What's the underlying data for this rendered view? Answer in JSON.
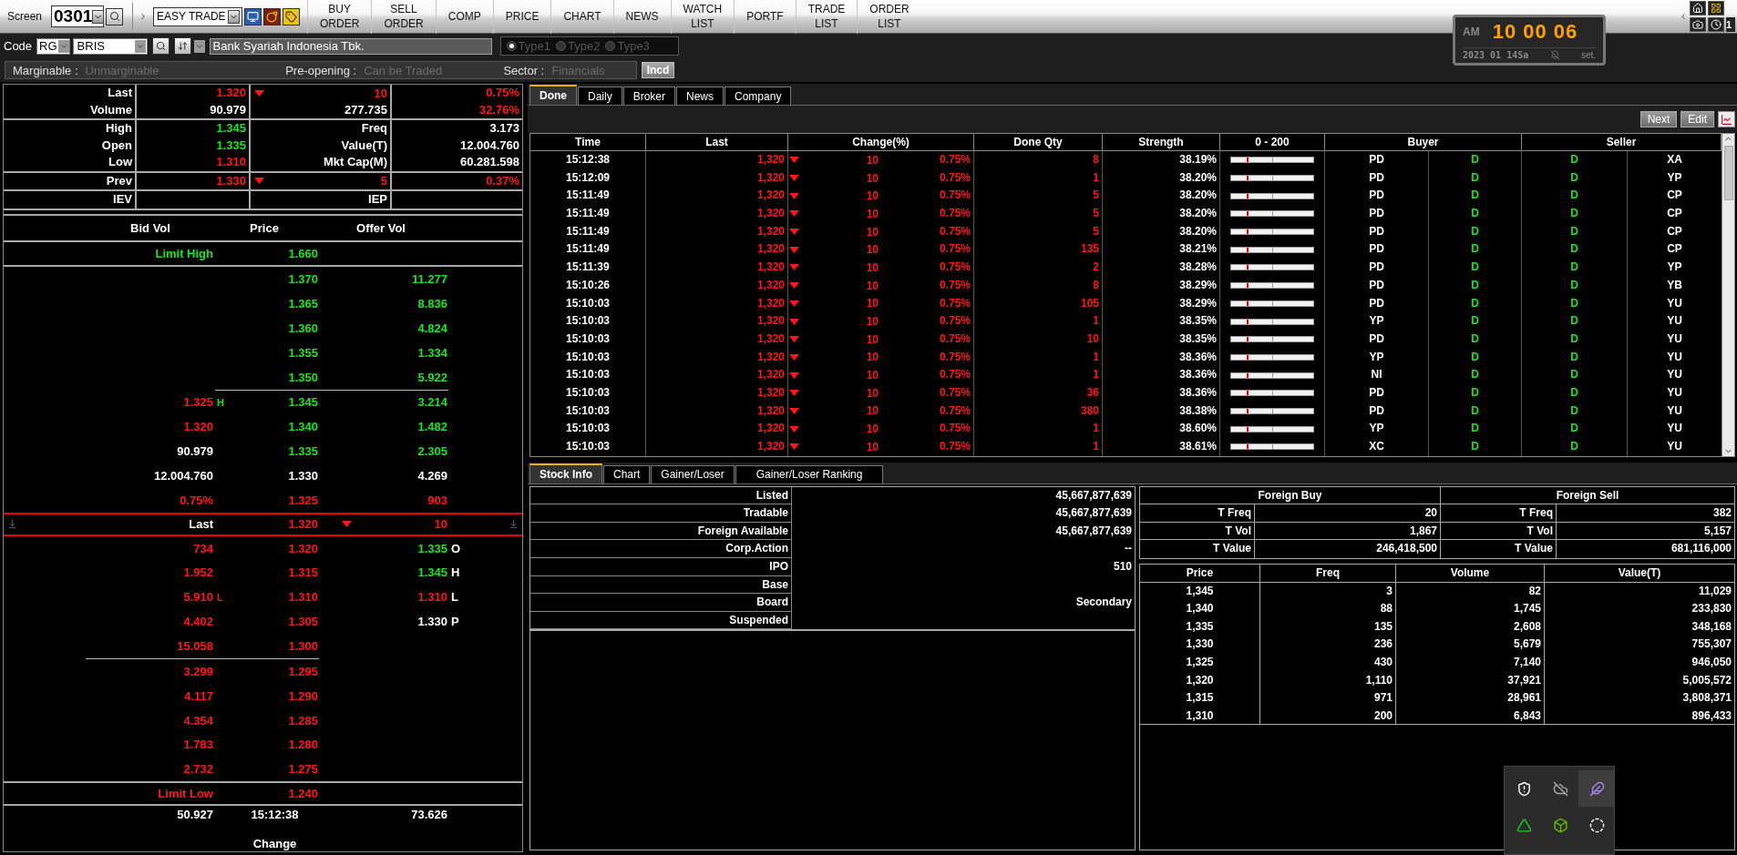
{
  "toolbar": {
    "screen_label": "Screen",
    "screen_code": "0301",
    "workspace": "EASY TRADE",
    "menu": [
      {
        "lines": [
          "BUY",
          "ORDER"
        ]
      },
      {
        "lines": [
          "SELL",
          "ORDER"
        ]
      },
      {
        "lines": [
          "COMP"
        ]
      },
      {
        "lines": [
          "PRICE"
        ]
      },
      {
        "lines": [
          "CHART"
        ]
      },
      {
        "lines": [
          "NEWS"
        ]
      },
      {
        "lines": [
          "WATCH",
          "LIST"
        ]
      },
      {
        "lines": [
          "PORTF"
        ]
      },
      {
        "lines": [
          "TRADE",
          "LIST"
        ]
      },
      {
        "lines": [
          "ORDER",
          "LIST"
        ]
      }
    ],
    "corner_badge": "1"
  },
  "clock": {
    "period": "AM",
    "time": "10 00 06",
    "date": "2023 01 14Sa",
    "set": "set."
  },
  "code_bar": {
    "label": "Code",
    "board": "RG",
    "code": "BRIS",
    "name": "Bank Syariah Indonesia Tbk.",
    "types": [
      {
        "label": "Type1",
        "selected": true
      },
      {
        "label": "Type2",
        "selected": false
      },
      {
        "label": "Type3",
        "selected": false
      }
    ]
  },
  "info_bar": {
    "fields": [
      {
        "label": "Marginable :",
        "value": "Unmarginable"
      },
      {
        "label": "Pre-opening :",
        "value": "Can be Traded"
      },
      {
        "label": "Sector :",
        "value": "Financials"
      }
    ],
    "button": "Incd"
  },
  "summary": [
    {
      "rows": [
        {
          "cells": [
            {
              "kind": "label",
              "text": "Last"
            },
            {
              "kind": "value",
              "text": "1.320",
              "color": "#ff1818"
            },
            {
              "kind": "value",
              "text": "10",
              "color": "#ff1818",
              "falling": true
            },
            {
              "kind": "value",
              "text": "0.75%",
              "color": "#ff1818"
            }
          ]
        },
        {
          "cells": [
            {
              "kind": "label",
              "text": "Volume"
            },
            {
              "kind": "value",
              "text": "90.979",
              "color": "#ffffff"
            },
            {
              "kind": "value",
              "text": "277.735",
              "color": "#ffffff"
            },
            {
              "kind": "value",
              "text": "32.76%",
              "color": "#ff1818"
            }
          ]
        }
      ]
    },
    {
      "rows": [
        {
          "cells": [
            {
              "kind": "label",
              "text": "High"
            },
            {
              "kind": "value",
              "text": "1.345",
              "color": "#22e022"
            },
            {
              "kind": "label",
              "text": "Freq"
            },
            {
              "kind": "value",
              "text": "3.173",
              "color": "#ffffff"
            }
          ]
        },
        {
          "cells": [
            {
              "kind": "label",
              "text": "Open"
            },
            {
              "kind": "value",
              "text": "1.335",
              "color": "#22e022"
            },
            {
              "kind": "label",
              "text": "Value(T)"
            },
            {
              "kind": "value",
              "text": "12.004.760",
              "color": "#ffffff"
            }
          ]
        },
        {
          "cells": [
            {
              "kind": "label",
              "text": "Low"
            },
            {
              "kind": "value",
              "text": "1.310",
              "color": "#ff1818"
            },
            {
              "kind": "label",
              "text": "Mkt Cap(M)"
            },
            {
              "kind": "value",
              "text": "60.281.598",
              "color": "#ffffff"
            }
          ]
        }
      ]
    },
    {
      "rows": [
        {
          "cells": [
            {
              "kind": "label",
              "text": "Prev"
            },
            {
              "kind": "value",
              "text": "1.330",
              "color": "#ff1818"
            },
            {
              "kind": "value",
              "text": "5",
              "color": "#ff1818",
              "falling": true
            },
            {
              "kind": "value",
              "text": "0.37%",
              "color": "#ff1818"
            }
          ]
        }
      ]
    },
    {
      "rows": [
        {
          "cells": [
            {
              "kind": "label",
              "text": "IEV"
            },
            {
              "kind": "value"
            },
            {
              "kind": "label",
              "text": "IEP"
            },
            {
              "kind": "value"
            }
          ]
        }
      ]
    }
  ],
  "orderbook": {
    "columns": [
      "Bid Vol",
      "Price",
      "Offer Vol"
    ],
    "limit_high": {
      "label": "Limit High",
      "price": "1.660",
      "color": "#22e022"
    },
    "offers": [
      {
        "price": "1.370",
        "volume": "11.277",
        "color": "#22e022"
      },
      {
        "price": "1.365",
        "volume": "8.836",
        "color": "#22e022"
      },
      {
        "price": "1.360",
        "volume": "4.824",
        "color": "#22e022"
      },
      {
        "price": "1.355",
        "volume": "1.334",
        "color": "#22e022"
      },
      {
        "price": "1.350",
        "volume": "5.922",
        "color": "#22e022"
      },
      {
        "price": "1.345",
        "volume": "3.214",
        "color": "#22e022",
        "side": {
          "text": "1.325",
          "color": "#ff1818",
          "marker": {
            "text": "H",
            "color": "#22e022"
          }
        }
      },
      {
        "price": "1.340",
        "volume": "1.482",
        "color": "#22e022",
        "side": {
          "text": "1.320",
          "color": "#ff1818"
        }
      },
      {
        "price": "1.335",
        "volume": "2.305",
        "color": "#22e022",
        "side": {
          "text": "90.979",
          "color": "#ffffff"
        }
      },
      {
        "price": "1.330",
        "volume": "4.269",
        "color": "#ffffff",
        "side": {
          "text": "12.004.760",
          "color": "#ffffff"
        }
      },
      {
        "price": "1.325",
        "volume": "903",
        "color": "#ff1818",
        "side": {
          "text": "0.75%",
          "color": "#ff1818"
        }
      }
    ],
    "last": {
      "label": "Last",
      "price": "1.320",
      "color": "#ff1818",
      "falling": true,
      "change": "10"
    },
    "bids": [
      {
        "volume": "734",
        "price": "1.320",
        "color": "#ff1818",
        "side": {
          "text": "1.335",
          "color": "#22e022",
          "marker": {
            "text": "O",
            "color": "#ffffff"
          }
        }
      },
      {
        "volume": "1.952",
        "price": "1.315",
        "color": "#ff1818",
        "side": {
          "text": "1.345",
          "color": "#22e022",
          "marker": {
            "text": "H",
            "color": "#ffffff"
          }
        }
      },
      {
        "volume": "5.910",
        "price": "1.310",
        "color": "#ff1818",
        "marker": {
          "text": "L",
          "color": "#ff1818"
        },
        "side": {
          "text": "1.310",
          "color": "#ff1818",
          "marker": {
            "text": "L",
            "color": "#ffffff"
          }
        }
      },
      {
        "volume": "4.402",
        "price": "1.305",
        "color": "#ff1818",
        "side": {
          "text": "1.330",
          "color": "#ffffff",
          "marker": {
            "text": "P",
            "color": "#ffffff"
          }
        }
      },
      {
        "volume": "15.058",
        "price": "1.300",
        "color": "#ff1818"
      },
      {
        "volume": "3.299",
        "price": "1.295",
        "color": "#ff1818"
      },
      {
        "volume": "4.117",
        "price": "1.290",
        "color": "#ff1818"
      },
      {
        "volume": "4.354",
        "price": "1.285",
        "color": "#ff1818"
      },
      {
        "volume": "1.783",
        "price": "1.280",
        "color": "#ff1818"
      },
      {
        "volume": "2.732",
        "price": "1.275",
        "color": "#ff1818"
      }
    ],
    "limit_low": {
      "label": "Limit Low",
      "price": "1.240",
      "color": "#ff1818"
    },
    "footer": {
      "bid_total": "50.927",
      "time": "15:12:38",
      "offer_total": "73.626",
      "caption": "Change"
    }
  },
  "done_panel": {
    "tabs": [
      {
        "label": "Done",
        "selected": true
      },
      {
        "label": "Daily",
        "selected": false
      },
      {
        "label": "Broker",
        "selected": false
      },
      {
        "label": "News",
        "selected": false
      },
      {
        "label": "Company",
        "selected": false
      }
    ],
    "buttons": [
      "Next",
      "Edit"
    ],
    "columns": [
      "Time",
      "Last",
      "Change(%)",
      "Done Qty",
      "Strength",
      "0 - 200",
      "Buyer",
      "Seller"
    ],
    "rows": [
      {
        "time": "15:12:38",
        "last": "1,320",
        "color": "#ff1818",
        "falling": true,
        "change": "10",
        "pct": "0.75%",
        "qty": "8",
        "strength": "38.19%",
        "level": 0.19,
        "buyer": "PD",
        "buyer_type": "D",
        "seller_type": "D",
        "seller": "XA"
      },
      {
        "time": "15:12:09",
        "last": "1,320",
        "color": "#ff1818",
        "falling": true,
        "change": "10",
        "pct": "0.75%",
        "qty": "1",
        "strength": "38.20%",
        "level": 0.19,
        "buyer": "PD",
        "buyer_type": "D",
        "seller_type": "D",
        "seller": "YP"
      },
      {
        "time": "15:11:49",
        "last": "1,320",
        "color": "#ff1818",
        "falling": true,
        "change": "10",
        "pct": "0.75%",
        "qty": "5",
        "strength": "38.20%",
        "level": 0.19,
        "buyer": "PD",
        "buyer_type": "D",
        "seller_type": "D",
        "seller": "CP"
      },
      {
        "time": "15:11:49",
        "last": "1,320",
        "color": "#ff1818",
        "falling": true,
        "change": "10",
        "pct": "0.75%",
        "qty": "5",
        "strength": "38.20%",
        "level": 0.19,
        "buyer": "PD",
        "buyer_type": "D",
        "seller_type": "D",
        "seller": "CP"
      },
      {
        "time": "15:11:49",
        "last": "1,320",
        "color": "#ff1818",
        "falling": true,
        "change": "10",
        "pct": "0.75%",
        "qty": "5",
        "strength": "38.20%",
        "level": 0.19,
        "buyer": "PD",
        "buyer_type": "D",
        "seller_type": "D",
        "seller": "CP"
      },
      {
        "time": "15:11:49",
        "last": "1,320",
        "color": "#ff1818",
        "falling": true,
        "change": "10",
        "pct": "0.75%",
        "qty": "135",
        "strength": "38.21%",
        "level": 0.19,
        "buyer": "PD",
        "buyer_type": "D",
        "seller_type": "D",
        "seller": "CP"
      },
      {
        "time": "15:11:39",
        "last": "1,320",
        "color": "#ff1818",
        "falling": true,
        "change": "10",
        "pct": "0.75%",
        "qty": "2",
        "strength": "38.28%",
        "level": 0.19,
        "buyer": "PD",
        "buyer_type": "D",
        "seller_type": "D",
        "seller": "YP"
      },
      {
        "time": "15:10:26",
        "last": "1,320",
        "color": "#ff1818",
        "falling": true,
        "change": "10",
        "pct": "0.75%",
        "qty": "8",
        "strength": "38.29%",
        "level": 0.19,
        "buyer": "PD",
        "buyer_type": "D",
        "seller_type": "D",
        "seller": "YB"
      },
      {
        "time": "15:10:03",
        "last": "1,320",
        "color": "#ff1818",
        "falling": true,
        "change": "10",
        "pct": "0.75%",
        "qty": "105",
        "strength": "38.29%",
        "level": 0.19,
        "buyer": "PD",
        "buyer_type": "D",
        "seller_type": "D",
        "seller": "YU"
      },
      {
        "time": "15:10:03",
        "last": "1,320",
        "color": "#ff1818",
        "falling": true,
        "change": "10",
        "pct": "0.75%",
        "qty": "1",
        "strength": "38.35%",
        "level": 0.19,
        "buyer": "YP",
        "buyer_type": "D",
        "seller_type": "D",
        "seller": "YU"
      },
      {
        "time": "15:10:03",
        "last": "1,320",
        "color": "#ff1818",
        "falling": true,
        "change": "10",
        "pct": "0.75%",
        "qty": "10",
        "strength": "38.35%",
        "level": 0.19,
        "buyer": "PD",
        "buyer_type": "D",
        "seller_type": "D",
        "seller": "YU"
      },
      {
        "time": "15:10:03",
        "last": "1,320",
        "color": "#ff1818",
        "falling": true,
        "change": "10",
        "pct": "0.75%",
        "qty": "1",
        "strength": "38.36%",
        "level": 0.19,
        "buyer": "YP",
        "buyer_type": "D",
        "seller_type": "D",
        "seller": "YU"
      },
      {
        "time": "15:10:03",
        "last": "1,320",
        "color": "#ff1818",
        "falling": true,
        "change": "10",
        "pct": "0.75%",
        "qty": "1",
        "strength": "38.36%",
        "level": 0.19,
        "buyer": "NI",
        "buyer_type": "D",
        "seller_type": "D",
        "seller": "YU"
      },
      {
        "time": "15:10:03",
        "last": "1,320",
        "color": "#ff1818",
        "falling": true,
        "change": "10",
        "pct": "0.75%",
        "qty": "36",
        "strength": "38.36%",
        "level": 0.19,
        "buyer": "PD",
        "buyer_type": "D",
        "seller_type": "D",
        "seller": "YU"
      },
      {
        "time": "15:10:03",
        "last": "1,320",
        "color": "#ff1818",
        "falling": true,
        "change": "10",
        "pct": "0.75%",
        "qty": "380",
        "strength": "38.38%",
        "level": 0.19,
        "buyer": "PD",
        "buyer_type": "D",
        "seller_type": "D",
        "seller": "YU"
      },
      {
        "time": "15:10:03",
        "last": "1,320",
        "color": "#ff1818",
        "falling": true,
        "change": "10",
        "pct": "0.75%",
        "qty": "1",
        "strength": "38.60%",
        "level": 0.19,
        "buyer": "YP",
        "buyer_type": "D",
        "seller_type": "D",
        "seller": "YU"
      },
      {
        "time": "15:10:03",
        "last": "1,320",
        "color": "#ff1818",
        "falling": true,
        "change": "10",
        "pct": "0.75%",
        "qty": "1",
        "strength": "38.61%",
        "level": 0.19,
        "buyer": "XC",
        "buyer_type": "D",
        "seller_type": "D",
        "seller": "YU"
      }
    ]
  },
  "info_panel": {
    "tabs": [
      {
        "label": "Stock Info",
        "selected": true
      },
      {
        "label": "Chart",
        "selected": false
      },
      {
        "label": "Gainer/Loser",
        "selected": false
      },
      {
        "label": "Gainer/Loser Ranking",
        "selected": false
      }
    ],
    "stock_info": [
      {
        "label": "Listed",
        "value": "45,667,877,639"
      },
      {
        "label": "Tradable",
        "value": "45,667,877,639"
      },
      {
        "label": "Foreign Available",
        "value": "45,667,877,639"
      },
      {
        "label": "Corp.Action",
        "value": "--"
      },
      {
        "label": "IPO",
        "value": "510"
      },
      {
        "label": "Base"
      },
      {
        "label": "Board",
        "value": "Secondary"
      },
      {
        "label": "Suspended"
      }
    ],
    "foreign": {
      "buy_title": "Foreign Buy",
      "sell_title": "Foreign Sell",
      "rows": [
        {
          "buy_label": "T Freq",
          "buy": "20",
          "sell_label": "T Freq",
          "sell": "382"
        },
        {
          "buy_label": "T Vol",
          "buy": "1,867",
          "sell_label": "T Vol",
          "sell": "5,157"
        },
        {
          "buy_label": "T Value",
          "buy": "246,418,500",
          "sell_label": "T Value",
          "sell": "681,116,000"
        }
      ]
    },
    "price_table": {
      "columns": [
        "Price",
        "Freq",
        "Volume",
        "Value(T)"
      ],
      "rows": [
        [
          "1,345",
          "3",
          "82",
          "11,029"
        ],
        [
          "1,340",
          "88",
          "1,745",
          "233,830"
        ],
        [
          "1,335",
          "135",
          "2,608",
          "348,168"
        ],
        [
          "1,330",
          "236",
          "5,679",
          "755,307"
        ],
        [
          "1,325",
          "430",
          "7,140",
          "946,050"
        ],
        [
          "1,320",
          "1,110",
          "37,921",
          "5,005,572"
        ],
        [
          "1,315",
          "971",
          "28,961",
          "3,808,371"
        ],
        [
          "1,310",
          "200",
          "6,843",
          "896,433"
        ]
      ]
    }
  }
}
